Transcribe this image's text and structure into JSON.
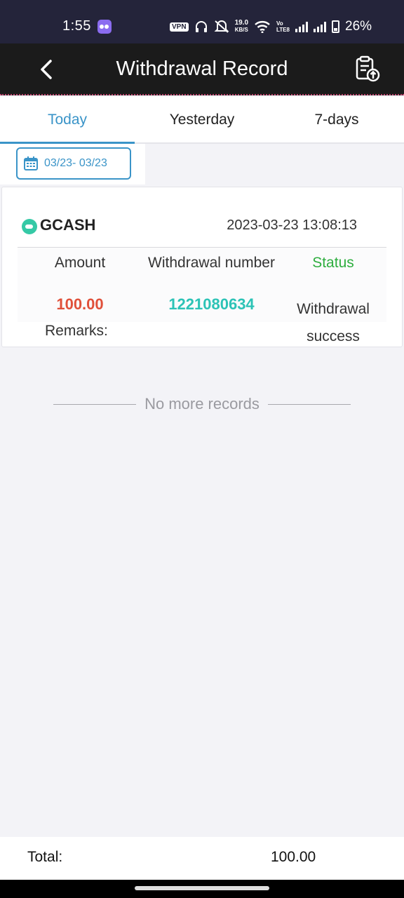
{
  "status_bar": {
    "time": "1:55",
    "vpn": "VPN",
    "speed_value": "19.0",
    "speed_unit": "KB/S",
    "lte_top": "Vo",
    "lte_bottom": "LTE8",
    "battery": "26%",
    "icons": [
      "app-badge-icon",
      "headphones-icon",
      "mute-icon",
      "wifi-icon",
      "signal-icon",
      "battery-icon"
    ]
  },
  "header": {
    "title": "Withdrawal Record",
    "back_icon": "chevron-left-icon",
    "action_icon": "clipboard-upload-icon"
  },
  "tabs": [
    {
      "label": "Today",
      "active": true
    },
    {
      "label": "Yesterday",
      "active": false
    },
    {
      "label": "7-days",
      "active": false
    }
  ],
  "date_filter": {
    "range": "03/23- 03/23",
    "icon": "calendar-icon"
  },
  "records": [
    {
      "method": "GCASH",
      "datetime": "2023-03-23 13:08:13",
      "headers": {
        "amount": "Amount",
        "number": "Withdrawal number",
        "status": "Status"
      },
      "amount": "100.00",
      "withdrawal_number": "1221080634",
      "status_line1": "Withdrawal",
      "status_line2": "success",
      "remarks_label": "Remarks:"
    }
  ],
  "no_more": "No more records",
  "footer": {
    "total_label": "Total:",
    "total_value": "100.00"
  },
  "colors": {
    "accent": "#3a94c8",
    "amount": "#e0503a",
    "number": "#2cc3b6",
    "status": "#2eae3f",
    "header_bg": "#1b1b1b"
  }
}
